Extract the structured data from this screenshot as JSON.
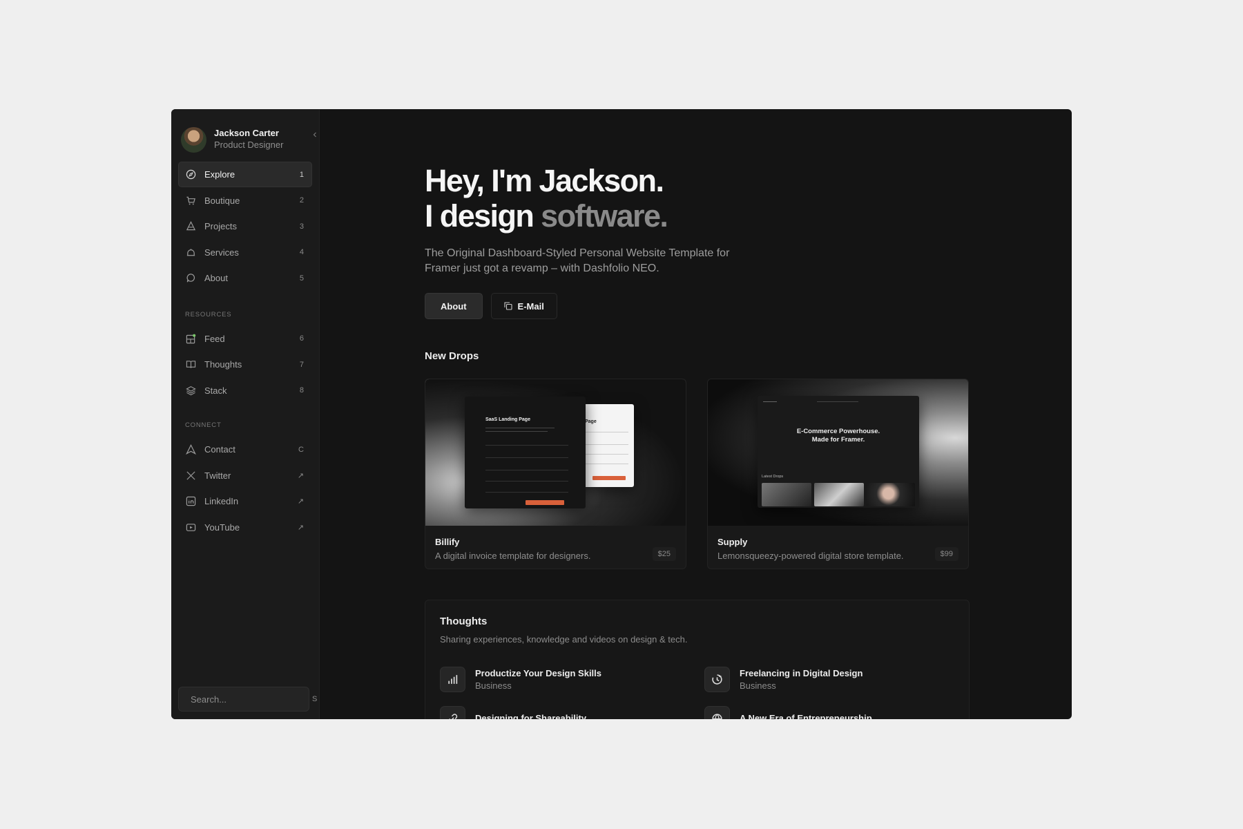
{
  "profile": {
    "name": "Jackson Carter",
    "role": "Product Designer"
  },
  "nav": {
    "main": [
      {
        "label": "Explore",
        "key": "1",
        "icon": "compass-icon",
        "active": true
      },
      {
        "label": "Boutique",
        "key": "2",
        "icon": "cart-icon"
      },
      {
        "label": "Projects",
        "key": "3",
        "icon": "flask-icon"
      },
      {
        "label": "Services",
        "key": "4",
        "icon": "bell-icon"
      },
      {
        "label": "About",
        "key": "5",
        "icon": "speech-icon"
      }
    ],
    "resources_label": "RESOURCES",
    "resources": [
      {
        "label": "Feed",
        "key": "6",
        "icon": "feed-icon"
      },
      {
        "label": "Thoughts",
        "key": "7",
        "icon": "book-icon"
      },
      {
        "label": "Stack",
        "key": "8",
        "icon": "layers-icon"
      }
    ],
    "connect_label": "CONNECT",
    "connect": [
      {
        "label": "Contact",
        "key": "C",
        "icon": "send-icon"
      },
      {
        "label": "Twitter",
        "key": "↗",
        "icon": "x-logo-icon"
      },
      {
        "label": "LinkedIn",
        "key": "↗",
        "icon": "linkedin-icon"
      },
      {
        "label": "YouTube",
        "key": "↗",
        "icon": "youtube-icon"
      }
    ]
  },
  "search": {
    "placeholder": "Search...",
    "key": "S"
  },
  "hero": {
    "line1": "Hey, I'm Jackson.",
    "line2_prefix": "I design",
    "line2_muted": "software.",
    "subtitle": "The Original Dashboard-Styled Personal Website Template for Framer just got a revamp – with Dashfolio NEO."
  },
  "buttons": {
    "about": "About",
    "email": "E-Mail"
  },
  "new_drops": {
    "title": "New Drops",
    "items": [
      {
        "name": "Billify",
        "desc": "A digital invoice template for designers.",
        "price": "$25",
        "mock_title": "SaaS Landing Page",
        "mock_title2": "nding Page"
      },
      {
        "name": "Supply",
        "desc": "Lemonsqueezy-powered digital store template.",
        "price": "$99",
        "mock_title": "E-Commerce Powerhouse.",
        "mock_title2": "Made for Framer.",
        "mock_label": "Latest Drops"
      }
    ]
  },
  "thoughts": {
    "title": "Thoughts",
    "subtitle": "Sharing experiences, knowledge and videos on design & tech.",
    "posts": [
      {
        "title": "Productize Your Design Skills",
        "category": "Business",
        "icon": "chart-icon"
      },
      {
        "title": "Freelancing in Digital Design",
        "category": "Business",
        "icon": "clock-icon"
      },
      {
        "title": "Designing for Shareability",
        "category": "",
        "icon": "link-icon"
      },
      {
        "title": "A New Era of Entrepreneurship",
        "category": "",
        "icon": "globe-icon"
      }
    ]
  },
  "colors": {
    "accent": "#d9603a",
    "window_bg": "#141414",
    "sidebar_bg": "#1b1b1b",
    "page_bg": "#efefef"
  }
}
